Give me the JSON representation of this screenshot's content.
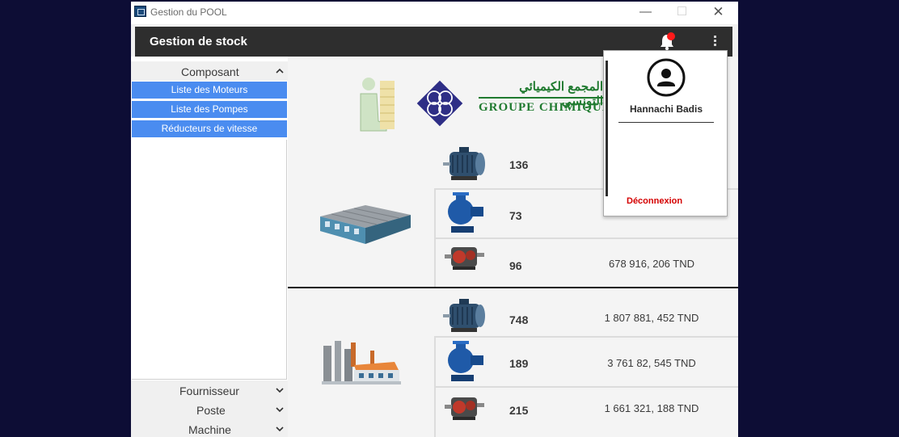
{
  "window": {
    "title": "Gestion du POOL",
    "minimize": "—",
    "maximize": "☐",
    "close": "✕"
  },
  "header": {
    "title": "Gestion de stock"
  },
  "sidebar": {
    "composant": {
      "label": "Composant",
      "items": [
        "Liste des Moteurs",
        "Liste des Pompes",
        "Réducteurs de vitesse"
      ]
    },
    "fournisseur": "Fournisseur",
    "poste": "Poste",
    "machine": "Machine"
  },
  "logo": {
    "brand_latin": "GROUPE CHIMIQUE",
    "brand_arabic": "المجمع الكيميائي التونسي"
  },
  "sites": [
    {
      "icon": "warehouse-icon",
      "rows": [
        {
          "component": "motor",
          "qty": "136",
          "amount": ""
        },
        {
          "component": "pump",
          "qty": "73",
          "amount": ""
        },
        {
          "component": "gear-reducer",
          "qty": "96",
          "amount": "678 916, 206 TND"
        }
      ]
    },
    {
      "icon": "factory-icon",
      "rows": [
        {
          "component": "motor",
          "qty": "748",
          "amount": "1 807 881, 452 TND"
        },
        {
          "component": "pump",
          "qty": "189",
          "amount": "3 761 82, 545 TND"
        },
        {
          "component": "gear-reducer",
          "qty": "215",
          "amount": "1 661 321, 188 TND"
        }
      ]
    }
  ],
  "user_menu": {
    "name": "Hannachi Badis",
    "logout": "Déconnexion"
  },
  "colors": {
    "accent": "#4a8cf0",
    "header": "#2e2e2e",
    "logout": "#d40000",
    "background": "#0d0d35"
  }
}
